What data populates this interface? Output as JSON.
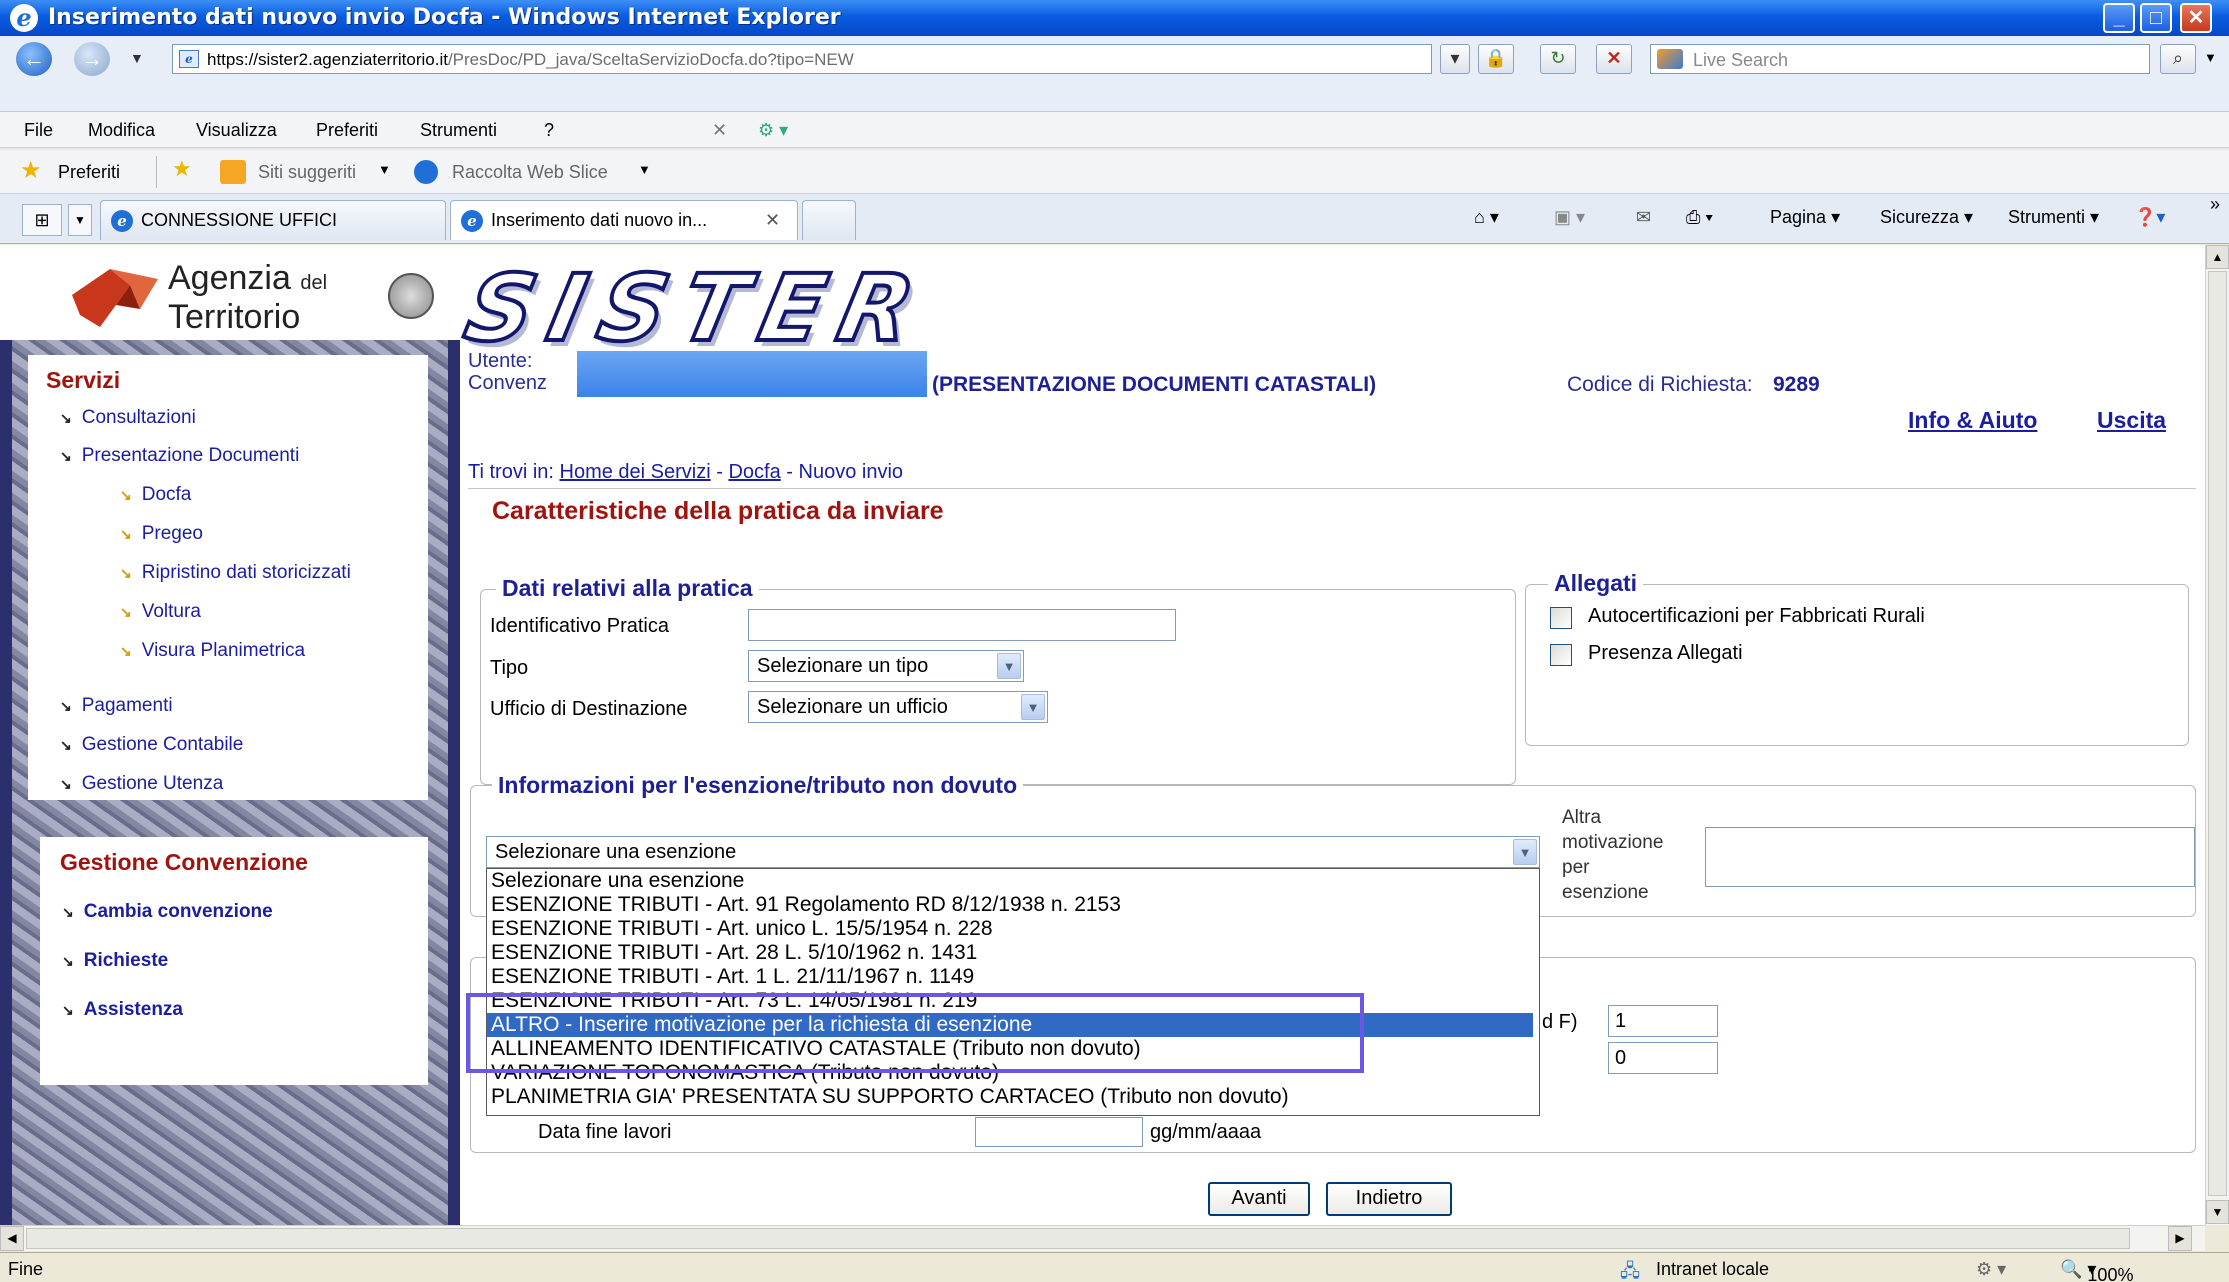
{
  "window": {
    "title": "Inserimento dati nuovo invio Docfa - Windows Internet Explorer"
  },
  "address": {
    "host": "https://sister2.agenziaterritorio.it",
    "path": "/PresDoc/PD_java/SceltaServizioDocfa.do?tipo=NEW"
  },
  "search": {
    "placeholder": "Live Search"
  },
  "menu": [
    "File",
    "Modifica",
    "Visualizza",
    "Preferiti",
    "Strumenti",
    "?"
  ],
  "favorites": {
    "label": "Preferiti",
    "suggested": "Siti suggeriti",
    "webslice": "Raccolta Web Slice"
  },
  "tabs": [
    {
      "label": "CONNESSIONE UFFICI"
    },
    {
      "label": "Inserimento dati nuovo in..."
    }
  ],
  "commandbar": {
    "page": "Pagina",
    "security": "Sicurezza",
    "tools": "Strumenti"
  },
  "brand": {
    "agency_line1": "Agenzia",
    "agency_del": "del",
    "agency_line2": "Territorio",
    "app_name": "SISTER"
  },
  "sidebar": {
    "services_title": "Servizi",
    "items": [
      {
        "label": "Consultazioni"
      },
      {
        "label": "Presentazione Documenti"
      },
      {
        "label": "Docfa"
      },
      {
        "label": "Pregeo"
      },
      {
        "label": "Ripristino dati storicizzati"
      },
      {
        "label": "Voltura"
      },
      {
        "label": "Visura Planimetrica"
      },
      {
        "label": "Pagamenti"
      },
      {
        "label": "Gestione Contabile"
      },
      {
        "label": "Gestione Utenza"
      }
    ],
    "convention_title": "Gestione Convenzione",
    "convention_items": [
      {
        "label": "Cambia convenzione"
      },
      {
        "label": "Richieste"
      },
      {
        "label": "Assistenza"
      }
    ]
  },
  "header": {
    "user_label": "Utente:",
    "convention_label": "Convenz",
    "service": "(PRESENTAZIONE DOCUMENTI CATASTALI)",
    "request_code_label": "Codice di Richiesta:",
    "request_code": "9289",
    "help": "Info & Aiuto",
    "exit": "Uscita"
  },
  "breadcrumb": {
    "prefix": "Ti trovi in:",
    "home": "Home dei Servizi",
    "sep": "-",
    "docfa": "Docfa",
    "current": "Nuovo invio"
  },
  "page_title": "Caratteristiche della pratica da inviare",
  "pratica": {
    "legend": "Dati relativi alla pratica",
    "id_label": "Identificativo Pratica",
    "id_value": "",
    "type_label": "Tipo",
    "type_value": "Selezionare un tipo",
    "office_label": "Ufficio di Destinazione",
    "office_value": "Selezionare un ufficio"
  },
  "allegati": {
    "legend": "Allegati",
    "options": [
      {
        "label": "Autocertificazioni per Fabbricati Rurali",
        "checked": false
      },
      {
        "label": "Presenza Allegati",
        "checked": false
      }
    ]
  },
  "esenzione": {
    "legend": "Informazioni per l'esenzione/tributo non dovuto",
    "select_value": "Selezionare una esenzione",
    "other_label": [
      "Altra",
      "motivazione",
      "per",
      "esenzione"
    ],
    "options": [
      "Selezionare una esenzione",
      "ESENZIONE TRIBUTI - Art. 91 Regolamento RD 8/12/1938 n. 2153",
      "ESENZIONE TRIBUTI - Art. unico L. 15/5/1954 n. 228",
      "ESENZIONE TRIBUTI - Art. 28 L. 5/10/1962 n. 1431",
      "ESENZIONE TRIBUTI - Art. 1 L. 21/11/1967 n. 1149",
      "ESENZIONE TRIBUTI - Art. 73 L. 14/05/1981 n. 219",
      "ALTRO - Inserire motivazione per la richiesta di esenzione",
      "ALLINEAMENTO IDENTIFICATIVO CATASTALE (Tributo non dovuto)",
      "VARIAZIONE TOPONOMASTICA (Tributo non dovuto)",
      "PLANIMETRIA GIA' PRESENTATA SU SUPPORTO CARTACEO (Tributo non dovuto)"
    ],
    "selected_index": 6
  },
  "lower": {
    "partial_label": "d F)",
    "field1_value": "1",
    "field2_value": "0",
    "end_date_label": "Data fine lavori",
    "date_format": "gg/mm/aaaa"
  },
  "buttons": {
    "next": "Avanti",
    "back": "Indietro"
  },
  "status": {
    "left": "Fine",
    "zone": "Intranet locale",
    "zoom": "100%"
  },
  "colors": {
    "accent": "#1e2095",
    "title_red": "#a0130e",
    "highlight": "#6a57e2",
    "selection": "#316ac5"
  }
}
